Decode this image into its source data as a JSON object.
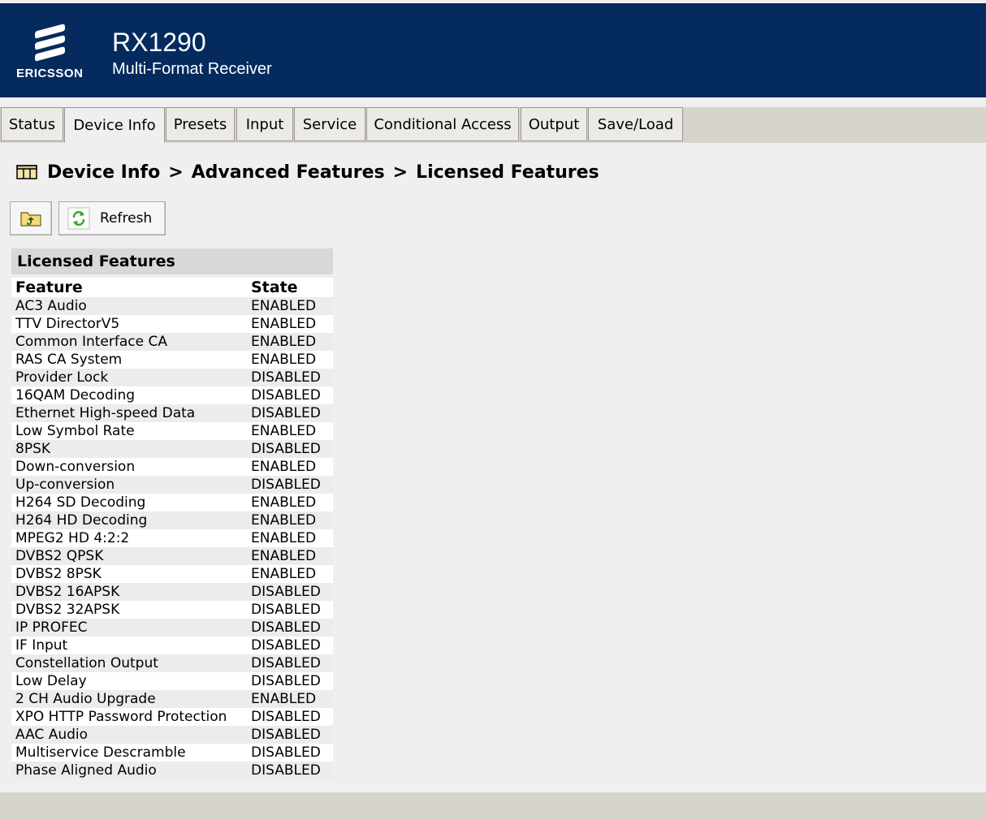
{
  "brand": {
    "logo_text": "ERICSSON",
    "product": "RX1290",
    "subtitle": "Multi-Format Receiver"
  },
  "tabs": [
    {
      "label": "Status"
    },
    {
      "label": "Device Info"
    },
    {
      "label": "Presets"
    },
    {
      "label": "Input"
    },
    {
      "label": "Service"
    },
    {
      "label": "Conditional Access"
    },
    {
      "label": "Output"
    },
    {
      "label": "Save/Load"
    }
  ],
  "breadcrumb": [
    "Device Info",
    "Advanced Features",
    "Licensed Features"
  ],
  "breadcrumb_sep": ">",
  "toolbar": {
    "refresh_label": "Refresh"
  },
  "table": {
    "title": "Licensed Features",
    "headers": {
      "feature": "Feature",
      "state": "State"
    },
    "rows": [
      {
        "feature": "AC3 Audio",
        "state": "ENABLED"
      },
      {
        "feature": "TTV DirectorV5",
        "state": "ENABLED"
      },
      {
        "feature": "Common Interface CA",
        "state": "ENABLED"
      },
      {
        "feature": "RAS CA System",
        "state": "ENABLED"
      },
      {
        "feature": "Provider Lock",
        "state": "DISABLED"
      },
      {
        "feature": "16QAM Decoding",
        "state": "DISABLED"
      },
      {
        "feature": "Ethernet High-speed Data",
        "state": "DISABLED"
      },
      {
        "feature": "Low Symbol Rate",
        "state": "ENABLED"
      },
      {
        "feature": "8PSK",
        "state": "DISABLED"
      },
      {
        "feature": "Down-conversion",
        "state": "ENABLED"
      },
      {
        "feature": "Up-conversion",
        "state": "DISABLED"
      },
      {
        "feature": "H264 SD Decoding",
        "state": "ENABLED"
      },
      {
        "feature": "H264 HD Decoding",
        "state": "ENABLED"
      },
      {
        "feature": "MPEG2 HD 4:2:2",
        "state": "ENABLED"
      },
      {
        "feature": "DVBS2 QPSK",
        "state": "ENABLED"
      },
      {
        "feature": "DVBS2 8PSK",
        "state": "ENABLED"
      },
      {
        "feature": "DVBS2 16APSK",
        "state": "DISABLED"
      },
      {
        "feature": "DVBS2 32APSK",
        "state": "DISABLED"
      },
      {
        "feature": "IP PROFEC",
        "state": "DISABLED"
      },
      {
        "feature": "IF Input",
        "state": "DISABLED"
      },
      {
        "feature": "Constellation Output",
        "state": "DISABLED"
      },
      {
        "feature": "Low Delay",
        "state": "DISABLED"
      },
      {
        "feature": "2 CH Audio Upgrade",
        "state": "ENABLED"
      },
      {
        "feature": "XPO HTTP Password Protection",
        "state": "DISABLED"
      },
      {
        "feature": "AAC Audio",
        "state": "DISABLED"
      },
      {
        "feature": "Multiservice Descramble",
        "state": "DISABLED"
      },
      {
        "feature": "Phase Aligned Audio",
        "state": "DISABLED"
      }
    ]
  },
  "icons": {
    "logo": "ericsson-logo-icon",
    "breadcrumb": "device-info-icon",
    "up": "folder-up-icon",
    "refresh": "refresh-icon"
  },
  "colors": {
    "header_bg": "#052a5e",
    "tabbar_bg": "#d6d4cb",
    "page_bg": "#f0eff0"
  }
}
